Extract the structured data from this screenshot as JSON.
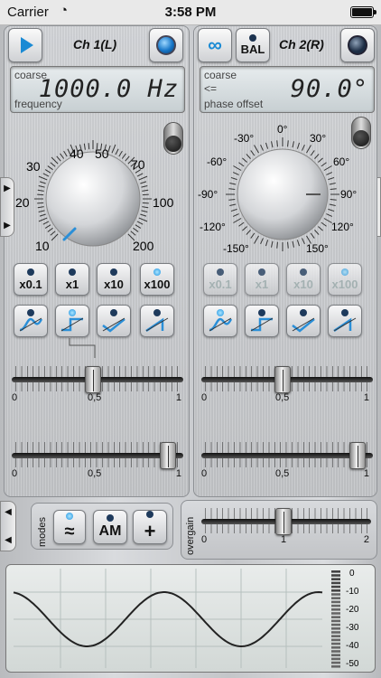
{
  "status": {
    "carrier": "Carrier",
    "time": "3:58 PM"
  },
  "ch1": {
    "title": "Ch 1(L)",
    "display": {
      "top_label": "coarse",
      "bottom_label": "frequency",
      "value": "1000.0 Hz"
    },
    "dial_labels": [
      "10",
      "20",
      "30",
      "40",
      "50",
      "70",
      "100",
      "200"
    ],
    "mult_buttons": [
      "x0.1",
      "x1",
      "x10",
      "x100"
    ],
    "slider1": {
      "position": 0.47,
      "scale": [
        "0",
        "0,5",
        "1"
      ]
    },
    "slider2": {
      "position": 0.95,
      "scale": [
        "0",
        "0,5",
        "1"
      ]
    }
  },
  "ch2": {
    "title": "Ch 2(R)",
    "bal_label": "BAL",
    "display": {
      "top_label": "coarse",
      "mid_label": "<=",
      "bottom_label": "phase offset",
      "value": "90.0°"
    },
    "dial_labels": [
      "0°",
      "30°",
      "60°",
      "90°",
      "120°",
      "150°",
      "-150°",
      "-120°",
      "-90°",
      "-60°",
      "-30°"
    ],
    "mult_buttons": [
      "x0.1",
      "x1",
      "x10",
      "x100"
    ],
    "slider1": {
      "position": 0.47,
      "scale": [
        "0",
        "0,5",
        "1"
      ]
    },
    "slider2": {
      "position": 0.95,
      "scale": [
        "0",
        "0,5",
        "1"
      ]
    }
  },
  "modes": {
    "label": "modes",
    "am_label": "AM"
  },
  "overgain": {
    "label": "overgain",
    "position": 0.48,
    "scale": [
      "0",
      "1",
      "2"
    ]
  },
  "scope": {
    "meter_scale": [
      "0",
      "-10",
      "-20",
      "-30",
      "-40",
      "-50"
    ]
  }
}
